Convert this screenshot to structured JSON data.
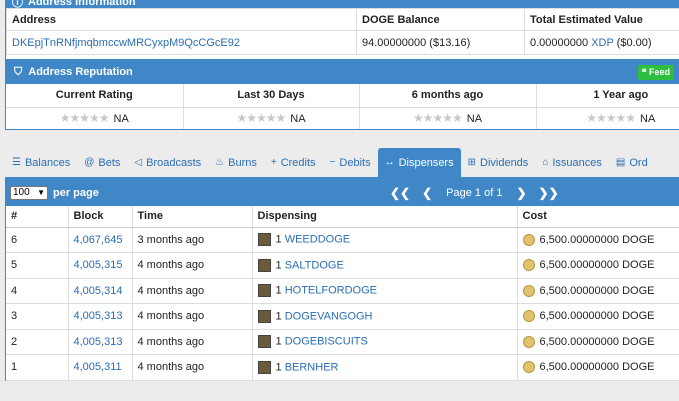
{
  "address_info": {
    "header": "Address Information",
    "columns": [
      "Address",
      "DOGE Balance",
      "Total Estimated Value"
    ],
    "address": "DKEpjTnRNfjmqbmccwMRCyxpM9QcCGcE92",
    "doge_balance": "94.00000000 ($13.16)",
    "est_value_amount": "0.00000000",
    "est_value_unit": "XDP",
    "est_value_usd": "($0.00)"
  },
  "reputation": {
    "header": "Address Reputation",
    "feed_label": "Feed",
    "columns": [
      "Current Rating",
      "Last 30 Days",
      "6 months ago",
      "1 Year ago"
    ],
    "values": [
      "NA",
      "NA",
      "NA",
      "NA"
    ]
  },
  "tabs": [
    {
      "label": "Balances",
      "icon": "list-icon"
    },
    {
      "label": "Bets",
      "icon": "at-icon"
    },
    {
      "label": "Broadcasts",
      "icon": "bullhorn-icon"
    },
    {
      "label": "Burns",
      "icon": "fire-icon"
    },
    {
      "label": "Credits",
      "icon": "plus-icon"
    },
    {
      "label": "Debits",
      "icon": "minus-icon"
    },
    {
      "label": "Dispensers",
      "icon": "arrows-icon"
    },
    {
      "label": "Dividends",
      "icon": "sitemap-icon"
    },
    {
      "label": "Issuances",
      "icon": "bank-icon"
    },
    {
      "label": "Ord",
      "icon": "book-icon"
    }
  ],
  "active_tab": "Dispensers",
  "dispensers": {
    "per_page_value": "100",
    "per_page_label": "per page",
    "pager_text": "Page 1 of 1",
    "columns": [
      "#",
      "Block",
      "Time",
      "Dispensing",
      "Cost"
    ],
    "rows": [
      {
        "num": "6",
        "block": "4,067,645",
        "time": "3 months ago",
        "qty": "1",
        "asset": "WEEDDOGE",
        "cost": "6,500.00000000 DOGE"
      },
      {
        "num": "5",
        "block": "4,005,315",
        "time": "4 months ago",
        "qty": "1",
        "asset": "SALTDOGE",
        "cost": "6,500.00000000 DOGE"
      },
      {
        "num": "4",
        "block": "4,005,314",
        "time": "4 months ago",
        "qty": "1",
        "asset": "HOTELFORDOGE",
        "cost": "6,500.00000000 DOGE"
      },
      {
        "num": "3",
        "block": "4,005,313",
        "time": "4 months ago",
        "qty": "1",
        "asset": "DOGEVANGOGH",
        "cost": "6,500.00000000 DOGE"
      },
      {
        "num": "2",
        "block": "4,005,313",
        "time": "4 months ago",
        "qty": "1",
        "asset": "DOGEBISCUITS",
        "cost": "6,500.00000000 DOGE"
      },
      {
        "num": "1",
        "block": "4,005,311",
        "time": "4 months ago",
        "qty": "1",
        "asset": "BERNHER",
        "cost": "6,500.00000000 DOGE"
      }
    ]
  },
  "colors": {
    "header_blue": "#3f87c7",
    "link_blue": "#2a6db5",
    "feed_green": "#2fbf3f"
  }
}
